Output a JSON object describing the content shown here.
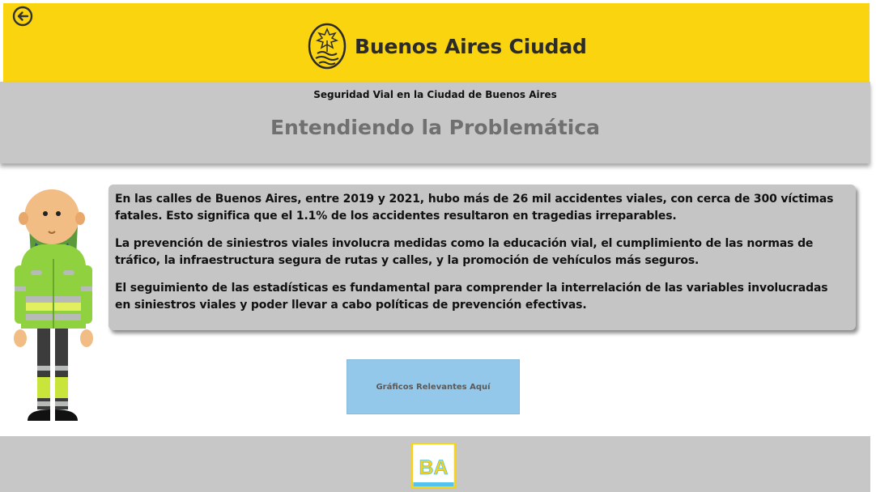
{
  "header": {
    "brand_name": "Buenos Aires Ciudad",
    "back_icon": "circle-arrow-left-icon",
    "seal_icon": "city-seal-icon"
  },
  "title_band": {
    "subtitle": "Seguridad Vial en la Ciudad de Buenos Aires",
    "title": "Entendiendo la Problemática"
  },
  "info": {
    "paragraphs": [
      "En las calles de Buenos Aires, entre 2019 y 2021, hubo más de 26 mil accidentes viales, con cerca de 300 víctimas fatales. Esto significa que el 1.1% de los accidentes resultaron en tragedias irreparables.",
      "La prevención de siniestros viales involucra medidas como la educación vial, el cumplimiento de las normas de tráfico, la infraestructura segura de rutas y calles, y la promoción de vehículos más seguros.",
      "El seguimiento de las estadísticas es fundamental para comprender la interrelación de las variables involucradas en siniestros viales y poder llevar a cabo políticas de prevención efectivas."
    ]
  },
  "actions": {
    "graphs_label": "Gráficos Relevantes Aquí"
  },
  "footer": {
    "logo_text": "BA"
  },
  "colors": {
    "header_yellow": "#f9d40f",
    "band_gray": "#c8c7c7",
    "button_blue": "#94c8ea"
  }
}
